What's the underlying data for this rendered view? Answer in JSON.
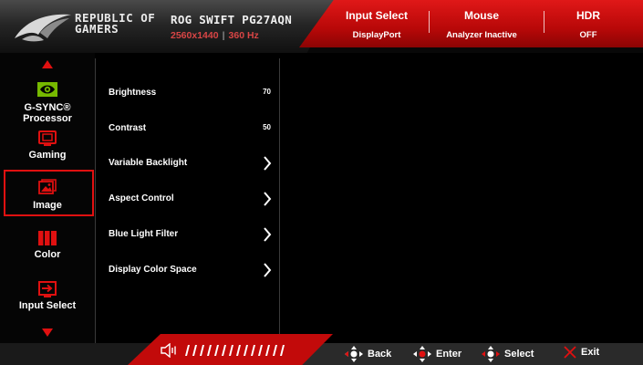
{
  "header": {
    "brand_line1": "REPUBLIC OF",
    "brand_line2": "GAMERS",
    "model": "ROG SWIFT PG27AQN",
    "resolution": "2560x1440",
    "refresh": "360 Hz",
    "status": [
      {
        "label": "Input Select",
        "value": "DisplayPort"
      },
      {
        "label": "Mouse",
        "value": "Analyzer Inactive"
      },
      {
        "label": "HDR",
        "value": "OFF"
      }
    ]
  },
  "sidebar": {
    "items": [
      {
        "label_line1": "G-SYNC®",
        "label_line2": "Processor",
        "icon": "nvidia-eye-icon"
      },
      {
        "label_line1": "Gaming",
        "icon": "gaming-monitor-icon"
      },
      {
        "label_line1": "Image",
        "icon": "image-icon",
        "selected": true
      },
      {
        "label_line1": "Color",
        "icon": "color-bars-icon"
      },
      {
        "label_line1": "Input Select",
        "icon": "input-arrow-icon"
      }
    ]
  },
  "menu": {
    "items": [
      {
        "label": "Brightness",
        "value": "70"
      },
      {
        "label": "Contrast",
        "value": "50"
      },
      {
        "label": "Variable Backlight",
        "submenu": true
      },
      {
        "label": "Aspect Control",
        "submenu": true
      },
      {
        "label": "Blue Light Filter",
        "submenu": true
      },
      {
        "label": "Display Color Space",
        "submenu": true
      }
    ]
  },
  "footer": {
    "volume_icon": "speaker-icon",
    "hints": [
      {
        "icon": "dpad-left-icon",
        "label": "Back"
      },
      {
        "icon": "dpad-press-icon",
        "label": "Enter"
      },
      {
        "icon": "dpad-horizontal-icon",
        "label": "Select"
      },
      {
        "icon": "close-x-icon",
        "label": "Exit"
      }
    ]
  },
  "colors": {
    "accent_red": "#e01010",
    "header_red": "#c40c0c",
    "nvidia_green": "#76b900",
    "background": "#000000"
  }
}
